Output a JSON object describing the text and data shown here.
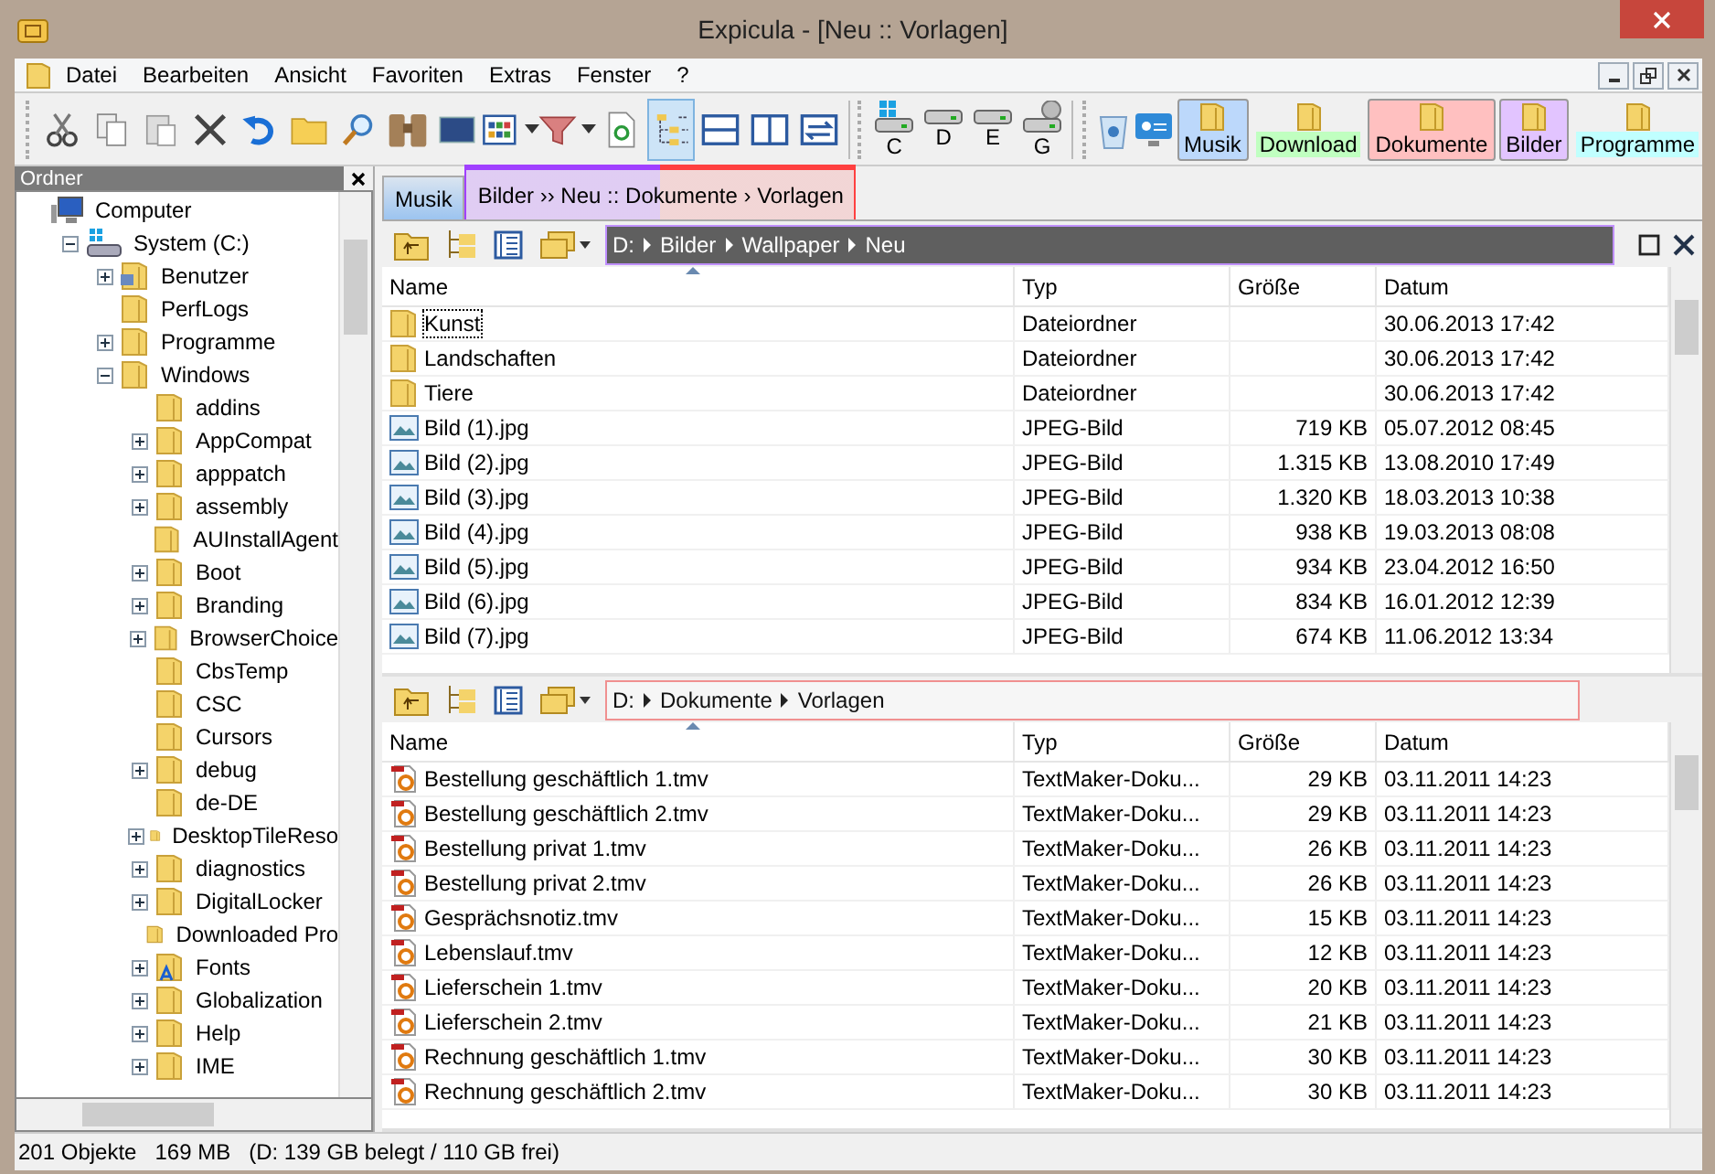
{
  "window": {
    "title": "Expicula - [Neu :: Vorlagen]"
  },
  "menu": [
    "Datei",
    "Bearbeiten",
    "Ansicht",
    "Favoriten",
    "Extras",
    "Fenster",
    "?"
  ],
  "toolbar": [
    {
      "kind": "cut",
      "selected": false
    },
    {
      "kind": "copy",
      "selected": false
    },
    {
      "kind": "paste",
      "selected": false
    },
    {
      "kind": "delete",
      "selected": false
    },
    {
      "kind": "undo",
      "selected": false
    },
    {
      "kind": "new-folder",
      "selected": false
    },
    {
      "kind": "search",
      "selected": false
    },
    {
      "kind": "binoculars",
      "selected": false
    },
    {
      "kind": "console",
      "selected": false
    },
    {
      "kind": "view",
      "selected": false
    },
    {
      "kind": "filter",
      "selected": false
    },
    {
      "kind": "refresh",
      "selected": false
    },
    {
      "kind": "tree",
      "selected": true
    },
    {
      "kind": "split-h",
      "selected": false
    },
    {
      "kind": "split-v",
      "selected": false
    },
    {
      "kind": "swap",
      "selected": false
    }
  ],
  "drives": [
    {
      "letter": "C",
      "kind": "system"
    },
    {
      "letter": "D",
      "kind": "disk"
    },
    {
      "letter": "E",
      "kind": "disk"
    },
    {
      "letter": "G",
      "kind": "network"
    }
  ],
  "favorites": [
    {
      "label": "Musik",
      "color": "#bcd8fb",
      "open": true
    },
    {
      "label": "Download",
      "color": "#c0ffc0",
      "open": false
    },
    {
      "label": "Dokumente",
      "color": "#ffc0c0",
      "open": true
    },
    {
      "label": "Bilder",
      "color": "#e2c4ff",
      "open": true
    },
    {
      "label": "Programme",
      "color": "#c0ffff",
      "open": false
    }
  ],
  "tree": {
    "title": "Ordner",
    "items": [
      {
        "label": "Computer",
        "kind": "computer",
        "toggle": false,
        "children": [
          {
            "label": "System (C:)",
            "kind": "drive",
            "toggle": true,
            "expanded": true,
            "children": [
              {
                "label": "Benutzer",
                "kind": "folder-users",
                "toggle": true,
                "expanded": false
              },
              {
                "label": "PerfLogs",
                "kind": "folder",
                "toggle": false,
                "expanded": false
              },
              {
                "label": "Programme",
                "kind": "folder",
                "toggle": true,
                "expanded": false
              },
              {
                "label": "Windows",
                "kind": "folder",
                "toggle": true,
                "expanded": true,
                "children": [
                  {
                    "label": "addins",
                    "kind": "folder",
                    "toggle": false,
                    "expanded": false
                  },
                  {
                    "label": "AppCompat",
                    "kind": "folder",
                    "toggle": true,
                    "expanded": false
                  },
                  {
                    "label": "apppatch",
                    "kind": "folder",
                    "toggle": true,
                    "expanded": false
                  },
                  {
                    "label": "assembly",
                    "kind": "folder",
                    "toggle": true,
                    "expanded": false
                  },
                  {
                    "label": "AUInstallAgent",
                    "kind": "folder",
                    "toggle": false,
                    "expanded": false
                  },
                  {
                    "label": "Boot",
                    "kind": "folder",
                    "toggle": true,
                    "expanded": false
                  },
                  {
                    "label": "Branding",
                    "kind": "folder",
                    "toggle": true,
                    "expanded": false
                  },
                  {
                    "label": "BrowserChoice",
                    "kind": "folder",
                    "toggle": true,
                    "expanded": false
                  },
                  {
                    "label": "CbsTemp",
                    "kind": "folder",
                    "toggle": false,
                    "expanded": false
                  },
                  {
                    "label": "CSC",
                    "kind": "folder",
                    "toggle": false,
                    "expanded": false
                  },
                  {
                    "label": "Cursors",
                    "kind": "folder",
                    "toggle": false,
                    "expanded": false
                  },
                  {
                    "label": "debug",
                    "kind": "folder",
                    "toggle": true,
                    "expanded": false
                  },
                  {
                    "label": "de-DE",
                    "kind": "folder",
                    "toggle": false,
                    "expanded": false
                  },
                  {
                    "label": "DesktopTileReso",
                    "kind": "folder",
                    "toggle": true,
                    "expanded": false
                  },
                  {
                    "label": "diagnostics",
                    "kind": "folder",
                    "toggle": true,
                    "expanded": false
                  },
                  {
                    "label": "DigitalLocker",
                    "kind": "folder",
                    "toggle": true,
                    "expanded": false
                  },
                  {
                    "label": "Downloaded Pro",
                    "kind": "folder",
                    "toggle": false,
                    "expanded": false
                  },
                  {
                    "label": "Fonts",
                    "kind": "folder-fonts",
                    "toggle": true,
                    "expanded": false
                  },
                  {
                    "label": "Globalization",
                    "kind": "folder",
                    "toggle": true,
                    "expanded": false
                  },
                  {
                    "label": "Help",
                    "kind": "folder",
                    "toggle": true,
                    "expanded": false
                  },
                  {
                    "label": "IME",
                    "kind": "folder",
                    "toggle": true,
                    "expanded": false
                  }
                ]
              }
            ]
          }
        ]
      }
    ]
  },
  "tabs": [
    {
      "label": "Musik",
      "selected": false,
      "segments": [
        {
          "color": "#9cc4f0"
        }
      ]
    },
    {
      "label": "Bilder ›› Neu :: Dokumente › Vorlagen",
      "selected": true,
      "segments": [
        {
          "color": "#a040ff"
        },
        {
          "color": "#ff4040"
        }
      ]
    }
  ],
  "panes": [
    {
      "active": true,
      "color": "#c090ff",
      "window_buttons": true,
      "path": [
        "D:",
        "Bilder",
        "Wallpaper",
        "Neu"
      ],
      "columns": [
        "Name",
        "Typ",
        "Größe",
        "Datum"
      ],
      "rows": [
        {
          "kind": "folder",
          "name": "Kunst",
          "type": "Dateiordner",
          "size": "",
          "date": "30.06.2013 17:42",
          "focused": true
        },
        {
          "kind": "folder",
          "name": "Landschaften",
          "type": "Dateiordner",
          "size": "",
          "date": "30.06.2013 17:42",
          "focused": false
        },
        {
          "kind": "folder",
          "name": "Tiere",
          "type": "Dateiordner",
          "size": "",
          "date": "30.06.2013 17:42",
          "focused": false
        },
        {
          "kind": "image",
          "name": "Bild (1).jpg",
          "type": "JPEG-Bild",
          "size": "719 KB",
          "date": "05.07.2012 08:45",
          "focused": false
        },
        {
          "kind": "image",
          "name": "Bild (2).jpg",
          "type": "JPEG-Bild",
          "size": "1.315 KB",
          "date": "13.08.2010 17:49",
          "focused": false
        },
        {
          "kind": "image",
          "name": "Bild (3).jpg",
          "type": "JPEG-Bild",
          "size": "1.320 KB",
          "date": "18.03.2013 10:38",
          "focused": false
        },
        {
          "kind": "image",
          "name": "Bild (4).jpg",
          "type": "JPEG-Bild",
          "size": "938 KB",
          "date": "19.03.2013 08:08",
          "focused": false
        },
        {
          "kind": "image",
          "name": "Bild (5).jpg",
          "type": "JPEG-Bild",
          "size": "934 KB",
          "date": "23.04.2012 16:50",
          "focused": false
        },
        {
          "kind": "image",
          "name": "Bild (6).jpg",
          "type": "JPEG-Bild",
          "size": "834 KB",
          "date": "16.01.2012 12:39",
          "focused": false
        },
        {
          "kind": "image",
          "name": "Bild (7).jpg",
          "type": "JPEG-Bild",
          "size": "674 KB",
          "date": "11.06.2012 13:34",
          "focused": false
        }
      ]
    },
    {
      "active": false,
      "color": "#f09090",
      "window_buttons": false,
      "path": [
        "D:",
        "Dokumente",
        "Vorlagen"
      ],
      "columns": [
        "Name",
        "Typ",
        "Größe",
        "Datum"
      ],
      "rows": [
        {
          "kind": "document",
          "name": "Bestellung geschäftlich 1.tmv",
          "type": "TextMaker-Doku...",
          "size": "29 KB",
          "date": "03.11.2011 14:23",
          "focused": false
        },
        {
          "kind": "document",
          "name": "Bestellung geschäftlich 2.tmv",
          "type": "TextMaker-Doku...",
          "size": "29 KB",
          "date": "03.11.2011 14:23",
          "focused": false
        },
        {
          "kind": "document",
          "name": "Bestellung privat 1.tmv",
          "type": "TextMaker-Doku...",
          "size": "26 KB",
          "date": "03.11.2011 14:23",
          "focused": false
        },
        {
          "kind": "document",
          "name": "Bestellung privat 2.tmv",
          "type": "TextMaker-Doku...",
          "size": "26 KB",
          "date": "03.11.2011 14:23",
          "focused": false
        },
        {
          "kind": "document",
          "name": "Gesprächsnotiz.tmv",
          "type": "TextMaker-Doku...",
          "size": "15 KB",
          "date": "03.11.2011 14:23",
          "focused": false
        },
        {
          "kind": "document",
          "name": "Lebenslauf.tmv",
          "type": "TextMaker-Doku...",
          "size": "12 KB",
          "date": "03.11.2011 14:23",
          "focused": false
        },
        {
          "kind": "document",
          "name": "Lieferschein 1.tmv",
          "type": "TextMaker-Doku...",
          "size": "20 KB",
          "date": "03.11.2011 14:23",
          "focused": false
        },
        {
          "kind": "document",
          "name": "Lieferschein 2.tmv",
          "type": "TextMaker-Doku...",
          "size": "21 KB",
          "date": "03.11.2011 14:23",
          "focused": false
        },
        {
          "kind": "document",
          "name": "Rechnung geschäftlich 1.tmv",
          "type": "TextMaker-Doku...",
          "size": "30 KB",
          "date": "03.11.2011 14:23",
          "focused": false
        },
        {
          "kind": "document",
          "name": "Rechnung geschäftlich 2.tmv",
          "type": "TextMaker-Doku...",
          "size": "30 KB",
          "date": "03.11.2011 14:23",
          "focused": false
        }
      ]
    }
  ],
  "status_bar": [
    "201 Objekte",
    "169 MB",
    "(D: 139 GB belegt / 110 GB frei)"
  ]
}
